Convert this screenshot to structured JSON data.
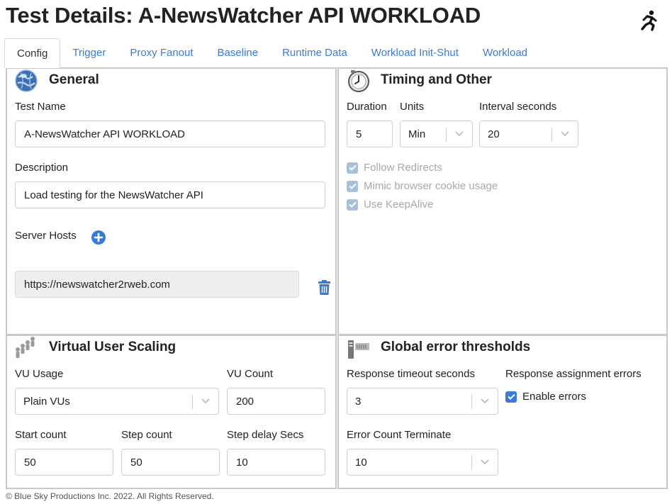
{
  "page": {
    "title": "Test Details: A-NewsWatcher API WORKLOAD",
    "run_icon": "running-person-icon"
  },
  "tabs": [
    {
      "label": "Config",
      "active": true
    },
    {
      "label": "Trigger"
    },
    {
      "label": "Proxy Fanout"
    },
    {
      "label": "Baseline"
    },
    {
      "label": "Runtime Data"
    },
    {
      "label": "Workload Init-Shut"
    },
    {
      "label": "Workload"
    }
  ],
  "general": {
    "title": "General",
    "icon": "globe-icon",
    "test_name_label": "Test Name",
    "test_name_value": "A-NewsWatcher API WORKLOAD",
    "description_label": "Description",
    "description_value": "Load testing for the NewsWatcher API",
    "server_hosts_label": "Server Hosts",
    "add_icon": "plus-circle-icon",
    "host_value": "https://newswatcher2rweb.com",
    "delete_icon": "trash-icon"
  },
  "timing": {
    "title": "Timing and Other",
    "icon": "clock-icon",
    "duration_label": "Duration",
    "duration_value": "5",
    "units_label": "Units",
    "units_value": "Min",
    "interval_label": "Interval seconds",
    "interval_value": "20",
    "follow_redirects": "Follow Redirects",
    "mimic_cookie": "Mimic browser cookie usage",
    "keepalive": "Use KeepAlive"
  },
  "vu": {
    "title": "Virtual User Scaling",
    "icon": "users-icon",
    "usage_label": "VU Usage",
    "usage_value": "Plain VUs",
    "count_label": "VU Count",
    "count_value": "200",
    "start_label": "Start count",
    "start_value": "50",
    "step_label": "Step count",
    "step_value": "50",
    "delay_label": "Step delay Secs",
    "delay_value": "10"
  },
  "errors": {
    "title": "Global error thresholds",
    "icon": "server-rack-icon",
    "timeout_label": "Response timeout seconds",
    "timeout_value": "3",
    "assignment_label": "Response assignment errors",
    "enable_errors": "Enable errors",
    "terminate_label": "Error Count Terminate",
    "terminate_value": "10"
  },
  "footer": {
    "text": "© Blue Sky Productions Inc. 2022. All Rights Reserved."
  },
  "colors": {
    "accent": "#3a7bd5",
    "panel_border": "#c9c9c9"
  }
}
